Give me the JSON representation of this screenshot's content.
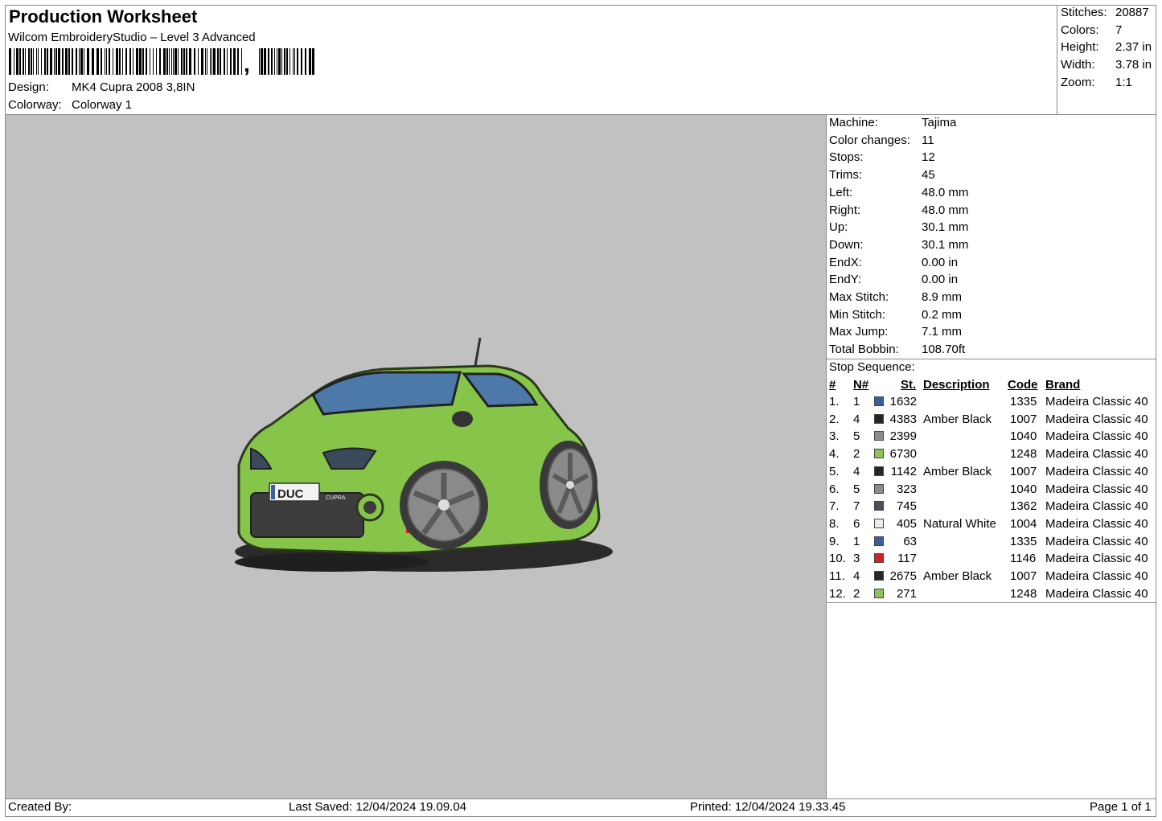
{
  "header": {
    "title": "Production Worksheet",
    "software": "Wilcom EmbroideryStudio – Level 3 Advanced",
    "barcode_suffix": ",",
    "design_label": "Design:",
    "design_value": "MK4 Cupra 2008 3,8IN",
    "colorway_label": "Colorway:",
    "colorway_value": "Colorway 1"
  },
  "summary": [
    {
      "label": "Stitches:",
      "value": "20887"
    },
    {
      "label": "Colors:",
      "value": "7"
    },
    {
      "label": "Height:",
      "value": "2.37 in"
    },
    {
      "label": "Width:",
      "value": "3.78 in"
    },
    {
      "label": "Zoom:",
      "value": "1:1"
    }
  ],
  "machine_info": [
    {
      "label": "Machine:",
      "value": "Tajima"
    },
    {
      "label": "Color changes:",
      "value": "11"
    },
    {
      "label": "Stops:",
      "value": "12"
    },
    {
      "label": "Trims:",
      "value": "45"
    },
    {
      "label": "Left:",
      "value": "48.0 mm"
    },
    {
      "label": "Right:",
      "value": "48.0 mm"
    },
    {
      "label": "Up:",
      "value": "30.1 mm"
    },
    {
      "label": "Down:",
      "value": "30.1 mm"
    },
    {
      "label": "EndX:",
      "value": "0.00 in"
    },
    {
      "label": "EndY:",
      "value": "0.00 in"
    },
    {
      "label": "Max Stitch:",
      "value": "8.9 mm"
    },
    {
      "label": "Min Stitch:",
      "value": "0.2 mm"
    },
    {
      "label": "Max Jump:",
      "value": "7.1 mm"
    },
    {
      "label": "Total Bobbin:",
      "value": "108.70ft"
    }
  ],
  "stop_sequence": {
    "title": "Stop Sequence:",
    "headers": {
      "num": "#",
      "needle": "N#",
      "stitches": "St.",
      "description": "Description",
      "code": "Code",
      "brand": "Brand"
    },
    "rows": [
      {
        "num": "1.",
        "needle": "1",
        "color": "#3a5fa0",
        "stitches": "1632",
        "description": "",
        "code": "1335",
        "brand": "Madeira Classic 40"
      },
      {
        "num": "2.",
        "needle": "4",
        "color": "#262626",
        "stitches": "4383",
        "description": "Amber Black",
        "code": "1007",
        "brand": "Madeira Classic 40"
      },
      {
        "num": "3.",
        "needle": "5",
        "color": "#8c8c8c",
        "stitches": "2399",
        "description": "",
        "code": "1040",
        "brand": "Madeira Classic 40"
      },
      {
        "num": "4.",
        "needle": "2",
        "color": "#8cc456",
        "stitches": "6730",
        "description": "",
        "code": "1248",
        "brand": "Madeira Classic 40"
      },
      {
        "num": "5.",
        "needle": "4",
        "color": "#262626",
        "stitches": "1142",
        "description": "Amber Black",
        "code": "1007",
        "brand": "Madeira Classic 40"
      },
      {
        "num": "6.",
        "needle": "5",
        "color": "#8c8c8c",
        "stitches": "323",
        "description": "",
        "code": "1040",
        "brand": "Madeira Classic 40"
      },
      {
        "num": "7.",
        "needle": "7",
        "color": "#4d4d5c",
        "stitches": "745",
        "description": "",
        "code": "1362",
        "brand": "Madeira Classic 40"
      },
      {
        "num": "8.",
        "needle": "6",
        "color": "#ececf0",
        "stitches": "405",
        "description": "Natural White",
        "code": "1004",
        "brand": "Madeira Classic 40"
      },
      {
        "num": "9.",
        "needle": "1",
        "color": "#3a5fa0",
        "stitches": "63",
        "description": "",
        "code": "1335",
        "brand": "Madeira Classic 40"
      },
      {
        "num": "10.",
        "needle": "3",
        "color": "#d42222",
        "stitches": "117",
        "description": "",
        "code": "1146",
        "brand": "Madeira Classic 40"
      },
      {
        "num": "11.",
        "needle": "4",
        "color": "#262626",
        "stitches": "2675",
        "description": "Amber Black",
        "code": "1007",
        "brand": "Madeira Classic 40"
      },
      {
        "num": "12.",
        "needle": "2",
        "color": "#8cc456",
        "stitches": "271",
        "description": "",
        "code": "1248",
        "brand": "Madeira Classic 40"
      }
    ]
  },
  "design_preview": {
    "plate_text": "DUC",
    "badge_text": "CUPRA",
    "body_color": "#86c44a",
    "window_color": "#4d79a8"
  },
  "footer": {
    "created_by": "Created By:",
    "last_saved": "Last Saved: 12/04/2024 19.09.04",
    "printed": "Printed: 12/04/2024 19.33.45",
    "page": "Page 1 of 1"
  }
}
